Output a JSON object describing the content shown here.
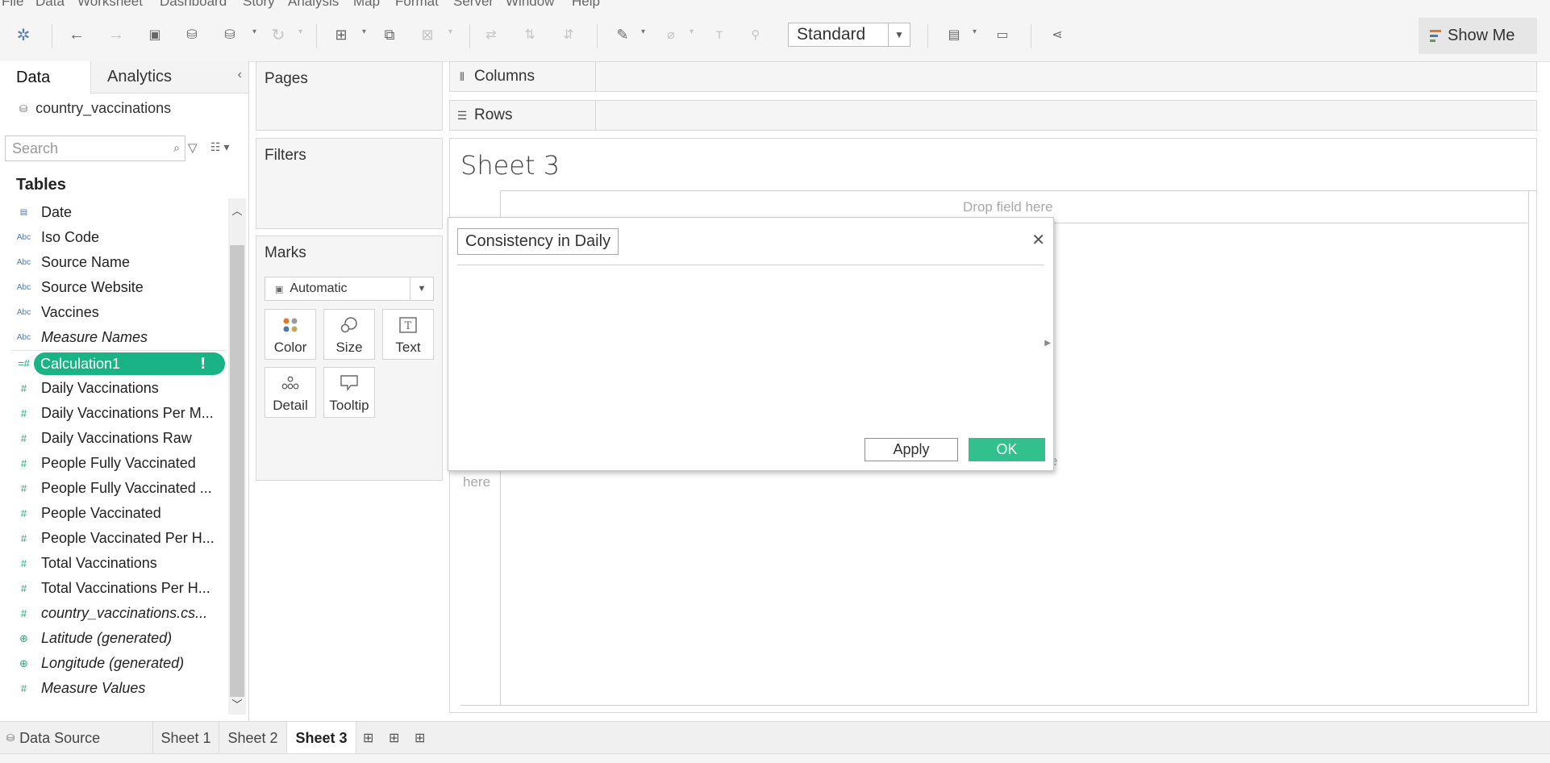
{
  "menu": [
    "File",
    "Data",
    "Worksheet",
    "Dashboard",
    "Story",
    "Analysis",
    "Map",
    "Format",
    "Server",
    "Window",
    "Help"
  ],
  "toolbar": {
    "fit_select": "Standard",
    "show_me": "Show Me"
  },
  "data_pane": {
    "tab_data": "Data",
    "tab_analytics": "Analytics",
    "datasource": "country_vaccinations",
    "search_placeholder": "Search",
    "tables_title": "Tables",
    "dimensions": [
      {
        "name": "Date",
        "icon": "date-icon"
      },
      {
        "name": "Iso Code",
        "icon": "abc-icon"
      },
      {
        "name": "Source Name",
        "icon": "abc-icon"
      },
      {
        "name": "Source Website",
        "icon": "abc-icon"
      },
      {
        "name": "Vaccines",
        "icon": "abc-icon"
      },
      {
        "name": "Measure Names",
        "icon": "abc-icon"
      }
    ],
    "calc_field": "Calculation1",
    "measures": [
      {
        "name": "Daily Vaccinations",
        "icon": "number-icon"
      },
      {
        "name": "Daily Vaccinations Per M...",
        "icon": "number-icon"
      },
      {
        "name": "Daily Vaccinations Raw",
        "icon": "number-icon"
      },
      {
        "name": "People Fully Vaccinated",
        "icon": "number-icon"
      },
      {
        "name": "People Fully Vaccinated ...",
        "icon": "number-icon"
      },
      {
        "name": "People Vaccinated",
        "icon": "number-icon"
      },
      {
        "name": "People Vaccinated Per H...",
        "icon": "number-icon"
      },
      {
        "name": "Total Vaccinations",
        "icon": "number-icon"
      },
      {
        "name": "Total Vaccinations Per H...",
        "icon": "number-icon"
      },
      {
        "name": "country_vaccinations.cs...",
        "icon": "number-icon"
      },
      {
        "name": "Latitude (generated)",
        "icon": "globe-icon"
      },
      {
        "name": "Longitude (generated)",
        "icon": "globe-icon"
      },
      {
        "name": "Measure Values",
        "icon": "number-icon"
      }
    ]
  },
  "cards": {
    "pages": "Pages",
    "filters": "Filters",
    "marks": "Marks",
    "marks_type": "Automatic",
    "mark_buttons": [
      "Color",
      "Size",
      "Text",
      "Detail",
      "Tooltip"
    ]
  },
  "shelves": {
    "columns": "Columns",
    "rows": "Rows"
  },
  "view": {
    "sheet_title": "Sheet 3",
    "drop_field": "Drop field here",
    "drop_row": "here",
    "drop_mid": "e"
  },
  "calc_dialog": {
    "name": "Consistency in Daily",
    "apply": "Apply",
    "ok": "OK"
  },
  "bottom_tabs": {
    "data_source": "Data Source",
    "sheets": [
      "Sheet 1",
      "Sheet 2",
      "Sheet 3"
    ],
    "active": "Sheet 3"
  },
  "colors": {
    "accent_green": "#1ab385",
    "ok_green": "#33c08f",
    "dimension_blue": "#4e79a7"
  }
}
